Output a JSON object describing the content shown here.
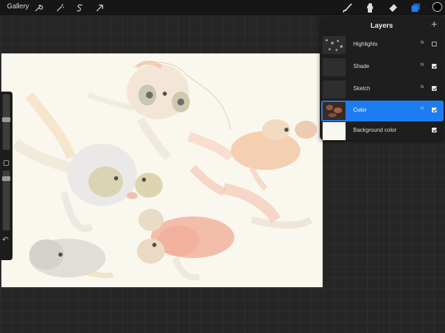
{
  "topbar": {
    "gallery_label": "Gallery",
    "left_tools": [
      "wrench-icon",
      "magic-wand-icon",
      "selection-s-icon",
      "transform-arrow-icon"
    ],
    "right_tools": [
      "brush-icon",
      "smudge-icon",
      "eraser-icon",
      "layers-icon"
    ],
    "active_color": "#000000",
    "layers_active_color": "#1d7df0"
  },
  "layers": {
    "title": "Layers",
    "items": [
      {
        "name": "Highlights",
        "blend": "N",
        "visible": false
      },
      {
        "name": "Shade",
        "blend": "N",
        "visible": true
      },
      {
        "name": "Sketch",
        "blend": "N",
        "visible": true
      },
      {
        "name": "Color",
        "blend": "N",
        "visible": true,
        "selected": true
      },
      {
        "name": "Background color",
        "visible": true
      }
    ]
  },
  "colors": {
    "canvas": "#faf8ee",
    "selected_row": "#1d7df0"
  }
}
